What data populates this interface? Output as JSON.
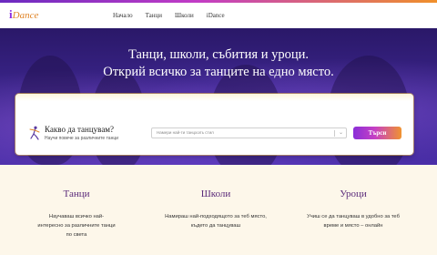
{
  "brand": {
    "logo_i": "i",
    "logo_rest": "Dance",
    "colors": {
      "purple": "#8a2be2",
      "orange": "#f0902a",
      "hero": "#3a248a",
      "feature_bg": "#fdf7ea"
    }
  },
  "nav": {
    "items": [
      "Начало",
      "Танци",
      "Школи",
      "iDance"
    ]
  },
  "hero": {
    "line1": "Танци, школи, събития и уроци.",
    "line2": "Открий всичко за танците на едно място."
  },
  "search": {
    "icon": "dancer-icon",
    "heading": "Какво да танцувам?",
    "subheading": "Научи повече за различните танци",
    "placeholder": "Намери най-ти танцхолъ стил",
    "button_label": "Търси"
  },
  "features": [
    {
      "title": "Танци",
      "text_line1": "Научаваш всичко най-",
      "text_line2": "интересно за различните танци",
      "text_line3": "по света"
    },
    {
      "title": "Школи",
      "text_line1": "Намираш най-подходящото за теб място,",
      "text_line2": "където да танцуваш",
      "text_line3": ""
    },
    {
      "title": "Уроци",
      "text_line1": "Учиш се да танцуваш в удобно за теб",
      "text_line2": "време и място – онлайн",
      "text_line3": ""
    }
  ]
}
